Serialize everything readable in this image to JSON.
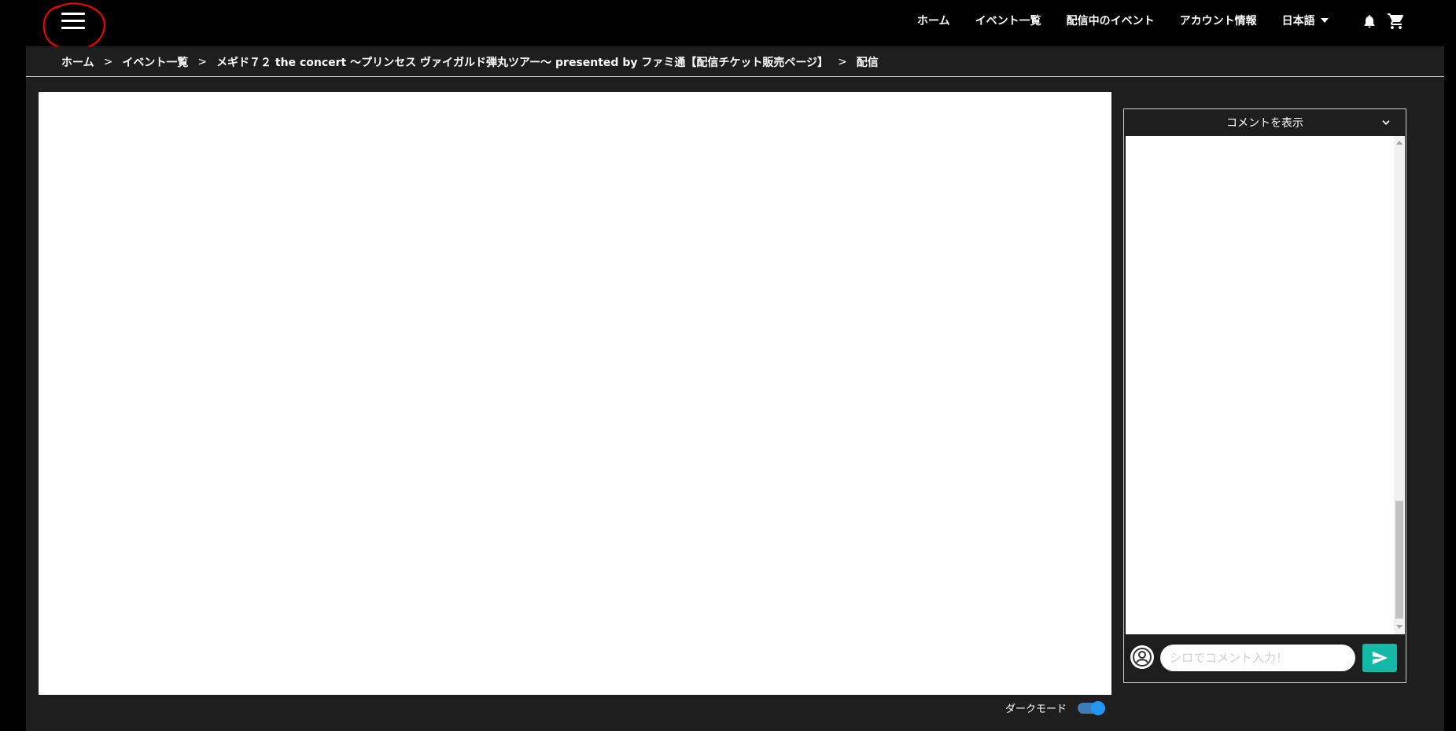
{
  "header": {
    "nav": [
      "ホーム",
      "イベント一覧",
      "配信中のイベント",
      "アカウント情報"
    ],
    "language": "日本語"
  },
  "breadcrumb": [
    "ホーム",
    "イベント一覧",
    "メギド７２ the concert 〜プリンセス ヴァイガルド弾丸ツアー〜 presented by ファミ通【配信チケット販売ページ】",
    "配信"
  ],
  "breadcrumb_separator": ">",
  "darkmode": {
    "label": "ダークモード",
    "enabled": true
  },
  "comments": {
    "header": "コメントを表示",
    "input_placeholder": "シロでコメント入力！",
    "input_value": ""
  },
  "colors": {
    "send": "#14b8a6",
    "toggle": "#2196f3",
    "annotation": "#ff0000"
  },
  "icons": [
    "menu-icon",
    "caret-down-icon",
    "bell-icon",
    "cart-icon",
    "chevron-down-icon",
    "user-circle-icon",
    "send-icon"
  ]
}
